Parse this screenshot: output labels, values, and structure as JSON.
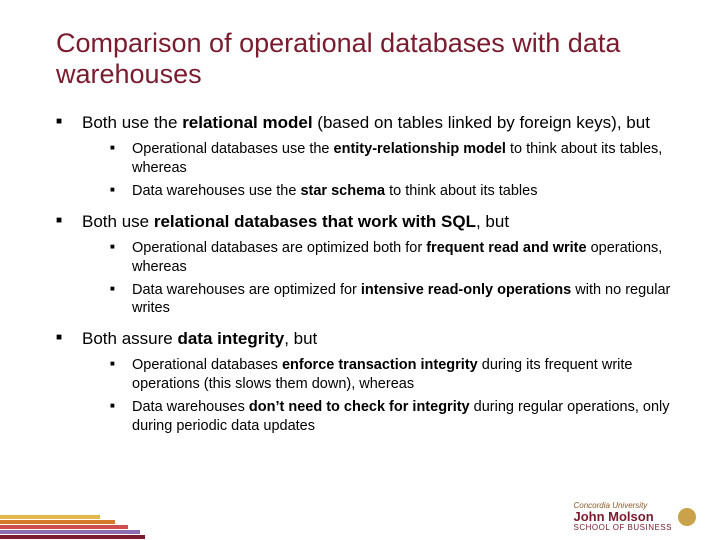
{
  "title": "Comparison of operational databases with data warehouses",
  "b1": {
    "pre": "Both use the ",
    "bold": "relational model",
    "post": " (based on tables linked by foreign keys), but",
    "s1": {
      "pre": "Operational databases use the ",
      "bold": "entity-relationship model",
      "post": " to think about its tables, whereas"
    },
    "s2": {
      "pre": "Data warehouses use the ",
      "bold": "star schema",
      "post": " to think about its tables"
    }
  },
  "b2": {
    "pre": "Both use ",
    "bold": "relational databases that work with SQL",
    "post": ", but",
    "s1": {
      "pre": "Operational databases are optimized both for ",
      "bold": "frequent read and write",
      "post": " operations, whereas"
    },
    "s2": {
      "pre": "Data warehouses are optimized for ",
      "bold": "intensive read-only operations",
      "post": " with no regular writes"
    }
  },
  "b3": {
    "pre": "Both assure ",
    "bold": "data integrity",
    "post": ", but",
    "s1": {
      "pre": "Operational databases ",
      "bold": "enforce transaction integrity",
      "post": " during its frequent write operations (this slows them down), whereas"
    },
    "s2": {
      "pre": "Data warehouses ",
      "bold": "don’t need to check for integrity",
      "post": " during regular operations, only during periodic data updates"
    }
  },
  "logo": {
    "university": "Concordia University",
    "name": "John Molson",
    "school": "SCHOOL OF BUSINESS"
  }
}
